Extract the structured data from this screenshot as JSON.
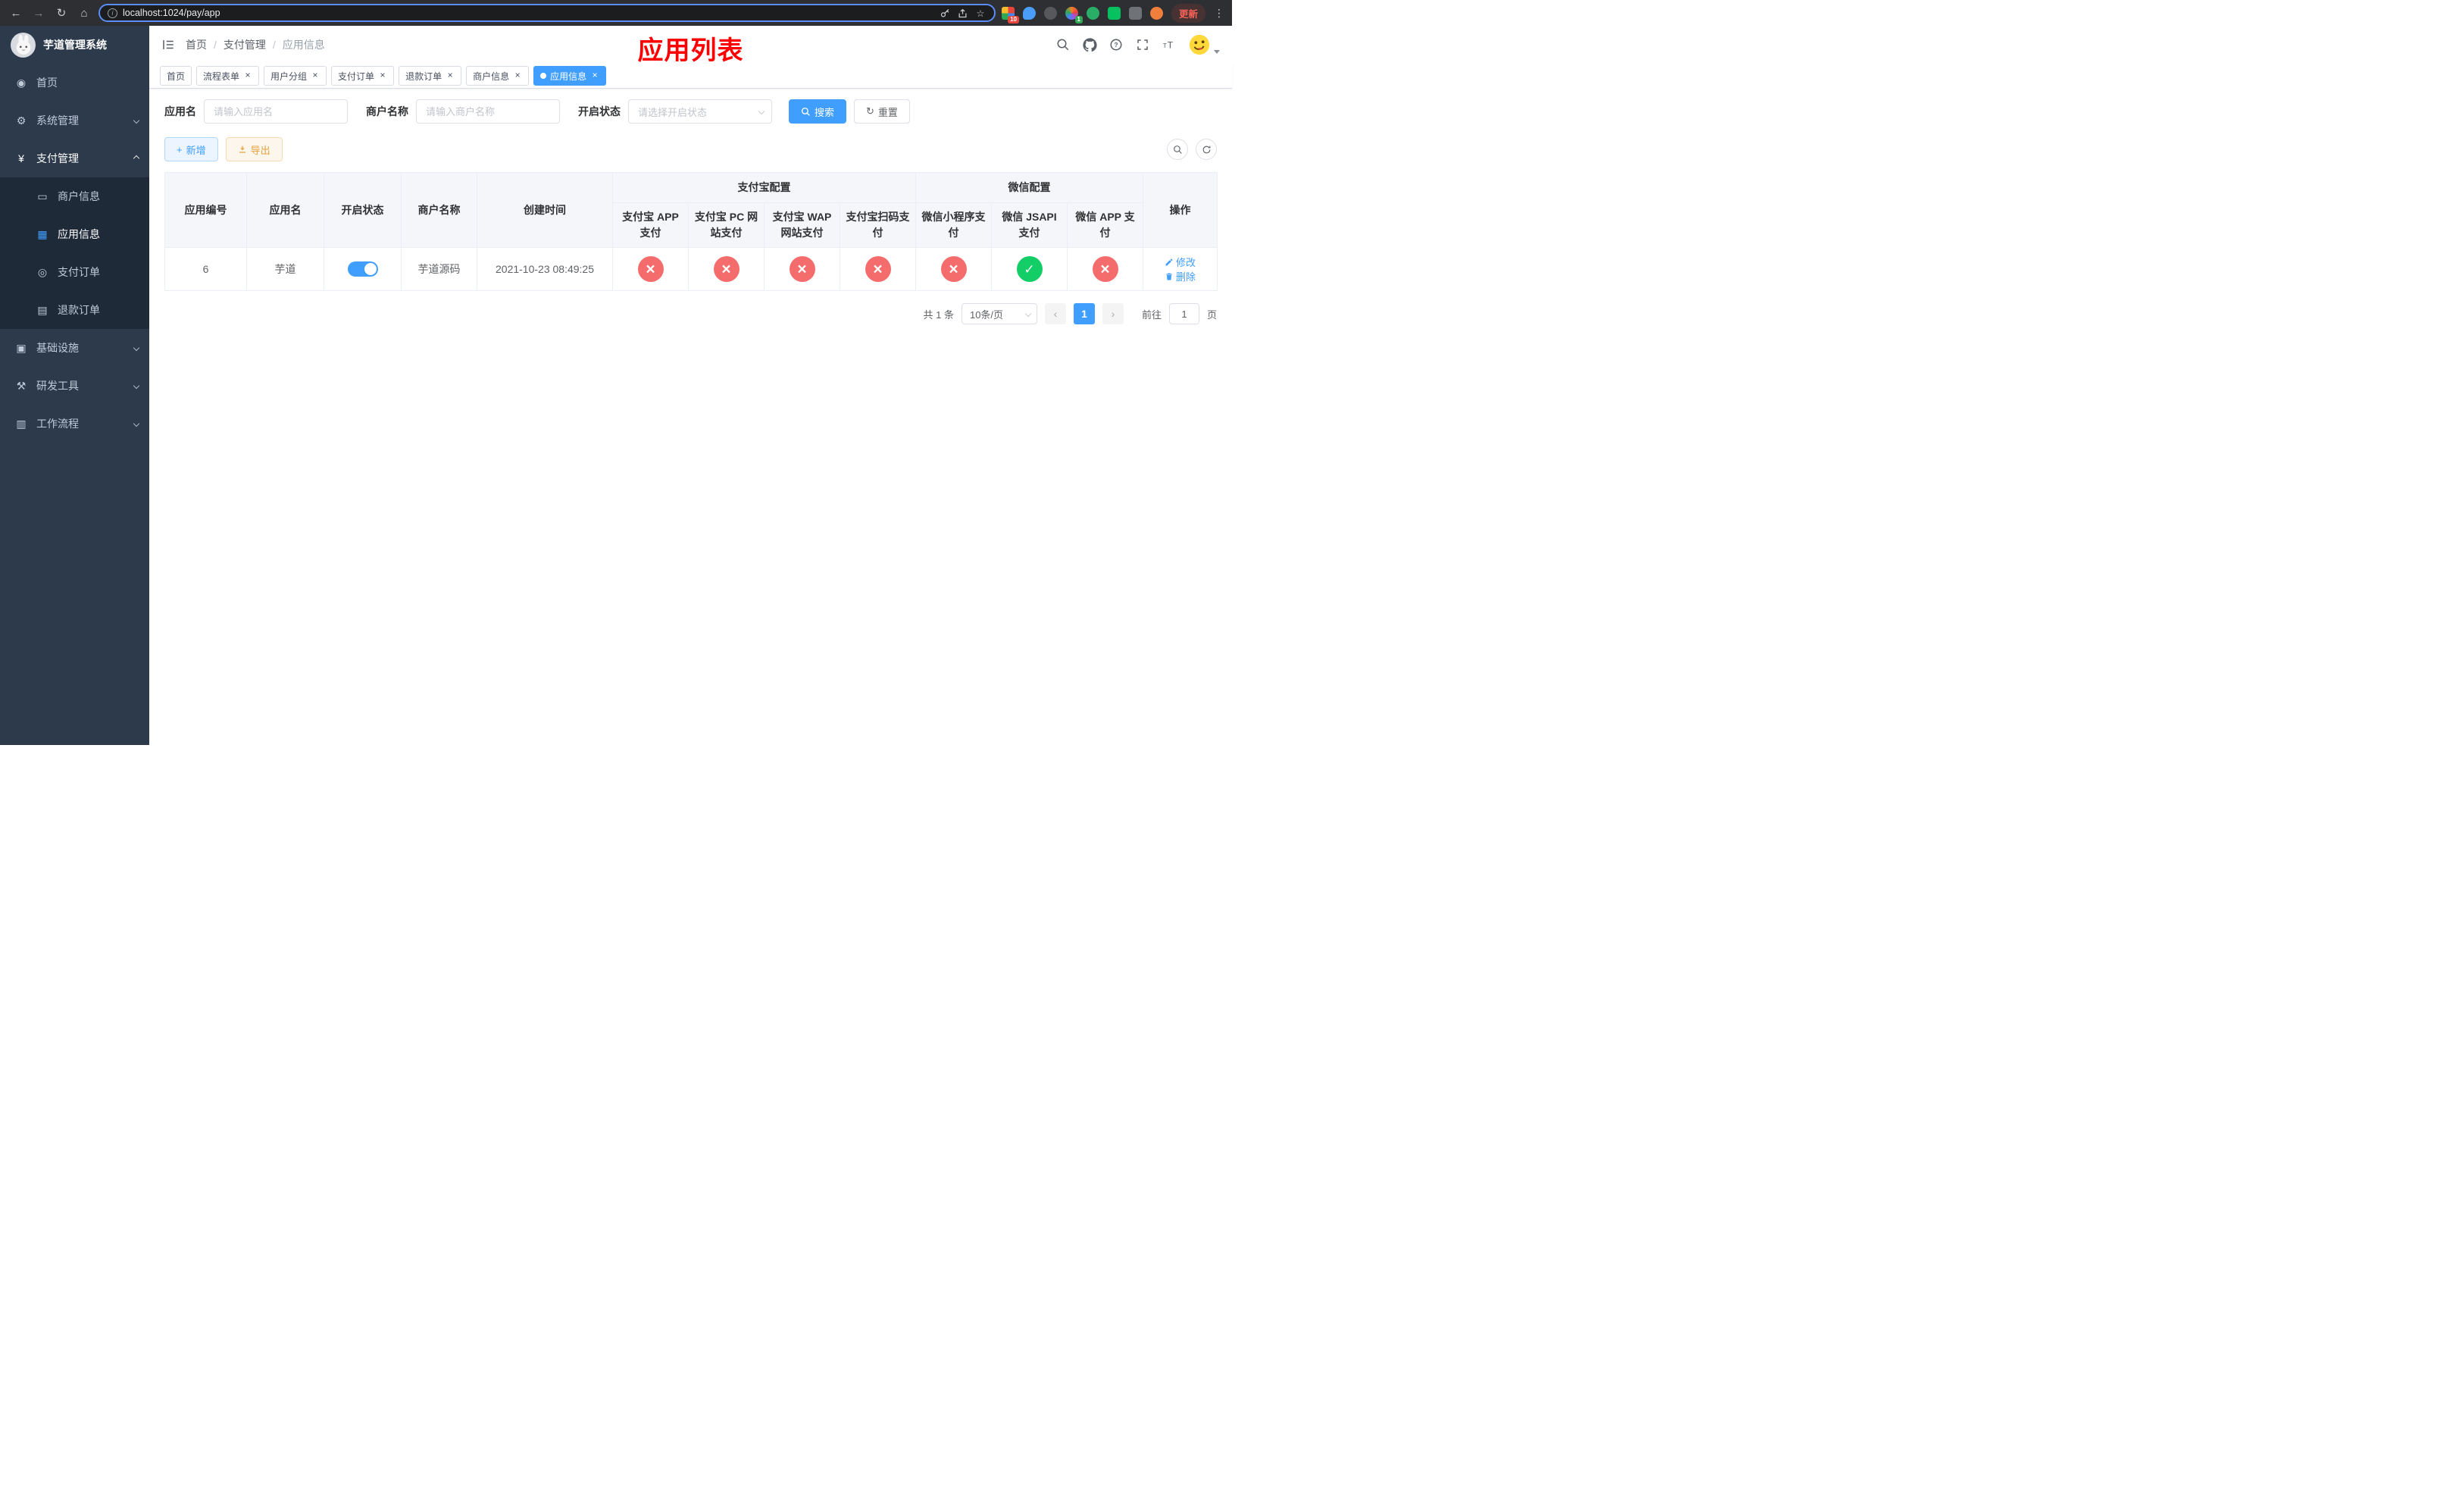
{
  "colors": {
    "accent": "#409eff",
    "danger": "#f56c6c",
    "success": "#13ce66",
    "warning": "#e6a23c",
    "sidebar_bg": "#2d3a4b",
    "submenu_bg": "#1f2a38"
  },
  "icons": {
    "back": "←",
    "forward": "→",
    "refresh": "↻",
    "home": "⌂",
    "info": "i",
    "star": "☆",
    "kebab": "⋮",
    "dashboard": "◉",
    "gear": "⚙",
    "yen": "¥",
    "card": "▭",
    "grid": "▦",
    "order": "◎",
    "refund": "▤",
    "infra": "▣",
    "tools": "⚒",
    "workflow": "▥",
    "plus": "+",
    "reset": "↻"
  },
  "browser": {
    "url": "localhost:1024/pay/app",
    "update_label": "更新",
    "ext_badge_1": "10",
    "ext_badge_4": "1"
  },
  "sidebar": {
    "logo_title": "芋道管理系统",
    "home": "首页",
    "system": "系统管理",
    "payment": "支付管理",
    "merchant_info": "商户信息",
    "app_info": "应用信息",
    "pay_order": "支付订单",
    "refund_order": "退款订单",
    "infra": "基础设施",
    "devtools": "研发工具",
    "workflow": "工作流程"
  },
  "header": {
    "breadcrumb": [
      "首页",
      "支付管理",
      "应用信息"
    ],
    "overlay_title": "应用列表"
  },
  "tabs": {
    "t0": "首页",
    "t1": "流程表单",
    "t2": "用户分组",
    "t3": "支付订单",
    "t4": "退款订单",
    "t5": "商户信息",
    "t6": "应用信息"
  },
  "filters": {
    "app_name_label": "应用名",
    "app_name_placeholder": "请输入应用名",
    "merchant_label": "商户名称",
    "merchant_placeholder": "请输入商户名称",
    "status_label": "开启状态",
    "status_placeholder": "请选择开启状态",
    "search_label": "搜索",
    "reset_label": "重置"
  },
  "toolbar": {
    "add_label": "新增",
    "export_label": "导出"
  },
  "table": {
    "col_app_id": "应用编号",
    "col_app_name": "应用名",
    "col_status": "开启状态",
    "col_merchant": "商户名称",
    "col_created": "创建时间",
    "group_alipay": "支付宝配置",
    "group_wechat": "微信配置",
    "col_alipay_app": "支付宝 APP 支付",
    "col_alipay_pc": "支付宝 PC 网站支付",
    "col_alipay_wap": "支付宝 WAP 网站支付",
    "col_alipay_qr": "支付宝扫码支付",
    "col_wx_mini": "微信小程序支付",
    "col_wx_jsapi": "微信 JSAPI 支付",
    "col_wx_app": "微信 APP 支付",
    "col_actions": "操作",
    "rows": [
      {
        "app_id": "6",
        "app_name": "芋道",
        "status": "on",
        "merchant": "芋道源码",
        "created": "2021-10-23 08:49:25",
        "alipay_app": "no",
        "alipay_pc": "no",
        "alipay_wap": "no",
        "alipay_qr": "no",
        "wx_mini": "no",
        "wx_jsapi": "yes",
        "wx_app": "no",
        "edit_label": "修改",
        "delete_label": "删除"
      }
    ]
  },
  "pagination": {
    "total": "共 1 条",
    "page_size": "10条/页",
    "page": "1",
    "goto_label": "前往",
    "goto_value": "1",
    "unit": "页"
  }
}
